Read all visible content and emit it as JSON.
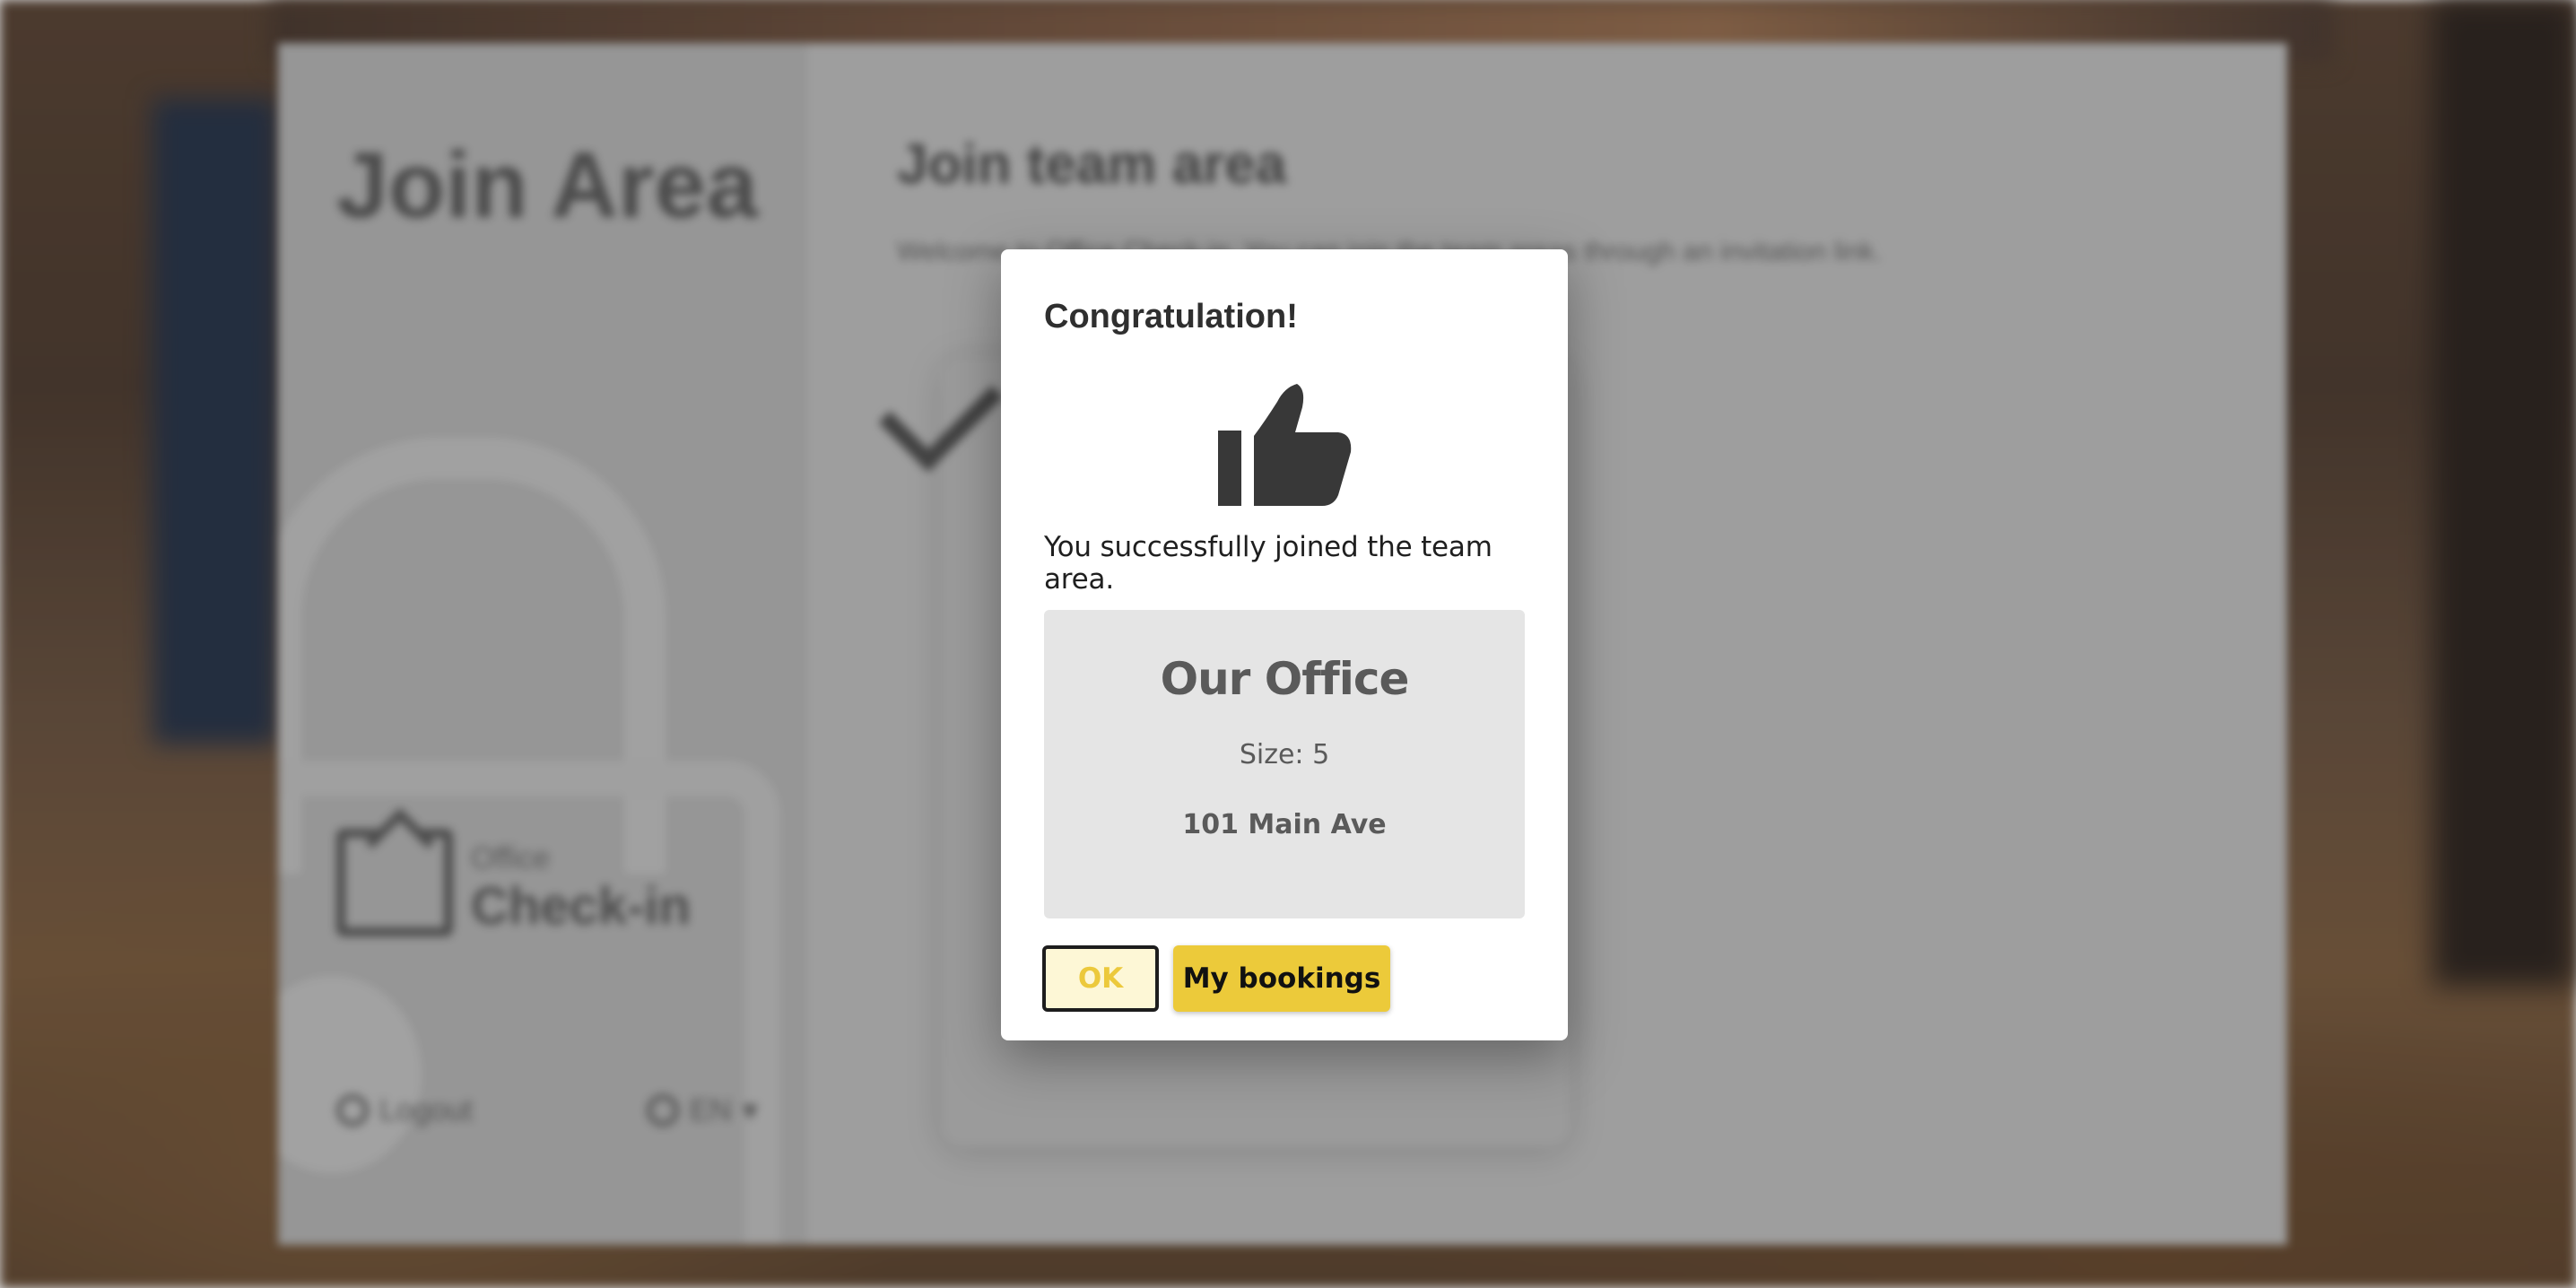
{
  "background_app": {
    "sidebar_title": "Join Area",
    "brand_small": "Office",
    "brand_big": "Check-in",
    "logout_label": "Logout",
    "language_label": "EN",
    "page_title": "Join team area",
    "page_description": "Welcome to Office Check-in. You can join the team areas through an invitation link."
  },
  "modal": {
    "title": "Congratulation!",
    "icon": "thumbs-up-icon",
    "message": "You successfully joined the team area.",
    "office": {
      "name": "Our Office",
      "size": "Size: 5",
      "address": "101 Main Ave"
    },
    "buttons": {
      "ok_label": "OK",
      "bookings_label": "My bookings"
    }
  },
  "colors": {
    "accent": "#ecca3a",
    "ok_text": "#ecc93c",
    "card_bg": "#e5e5e5"
  }
}
